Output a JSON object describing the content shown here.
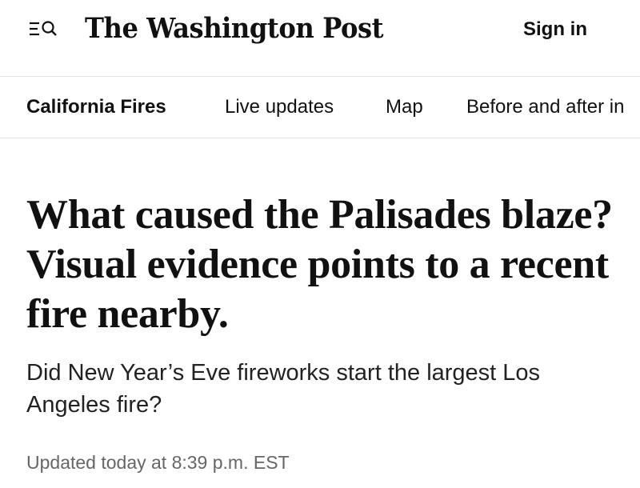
{
  "header": {
    "masthead": "The Washington Post",
    "sign_in_label": "Sign in",
    "menu_icon": "menu-search-icon"
  },
  "nav": {
    "items": [
      {
        "label": "California Fires",
        "active": true
      },
      {
        "label": "Live updates",
        "active": false
      },
      {
        "label": "Map",
        "active": false
      },
      {
        "label": "Before and after in",
        "active": false
      }
    ]
  },
  "article": {
    "headline": "What caused the Palisades blaze? Visual evidence points to a recent fire nearby.",
    "dek": "Did New Year’s Eve fireworks start the largest Los Angeles fire?",
    "timestamp": "Updated today at 8:39 p.m. EST"
  },
  "colors": {
    "text": "#111111",
    "divider": "#e6e6e6",
    "timestamp": "#666666"
  }
}
